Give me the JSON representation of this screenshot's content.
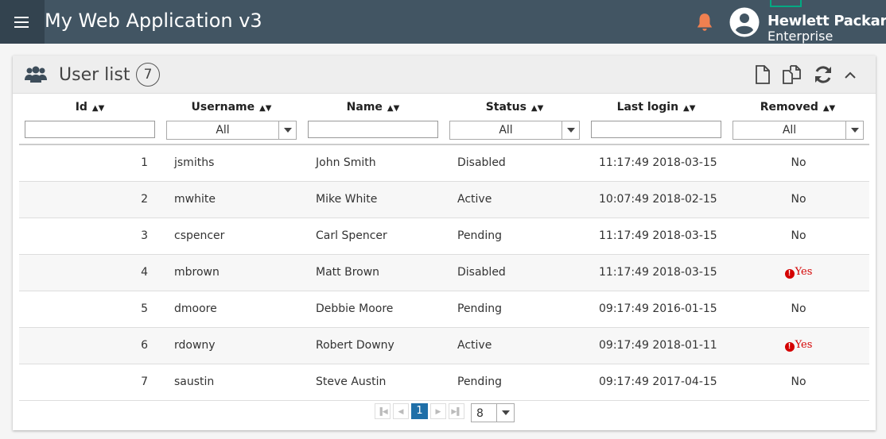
{
  "app": {
    "title": "My Web Application v3"
  },
  "brand": {
    "line1": "Hewlett Packard",
    "line2": "Enterprise"
  },
  "colors": {
    "topbar": "#425563",
    "brand_green": "#01a982",
    "bell": "#f08050",
    "error": "#d40000",
    "page_active": "#1f6fa8"
  },
  "card": {
    "title": "User list",
    "count": "7"
  },
  "columns": [
    {
      "label": "Id"
    },
    {
      "label": "Username"
    },
    {
      "label": "Name"
    },
    {
      "label": "Status"
    },
    {
      "label": "Last login"
    },
    {
      "label": "Removed"
    }
  ],
  "filters": {
    "username": "All",
    "status": "All",
    "removed": "All"
  },
  "rows": [
    {
      "id": "1",
      "username": "jsmiths",
      "name": "John Smith",
      "status": "Disabled",
      "last_login": "11:17:49 2018-03-15",
      "removed": "No"
    },
    {
      "id": "2",
      "username": "mwhite",
      "name": "Mike White",
      "status": "Active",
      "last_login": "10:07:49 2018-02-15",
      "removed": "No"
    },
    {
      "id": "3",
      "username": "cspencer",
      "name": "Carl Spencer",
      "status": "Pending",
      "last_login": "11:17:49 2018-03-15",
      "removed": "No"
    },
    {
      "id": "4",
      "username": "mbrown",
      "name": "Matt Brown",
      "status": "Disabled",
      "last_login": "11:17:49 2018-03-15",
      "removed": "Yes"
    },
    {
      "id": "5",
      "username": "dmoore",
      "name": "Debbie Moore",
      "status": "Pending",
      "last_login": "09:17:49 2016-01-15",
      "removed": "No"
    },
    {
      "id": "6",
      "username": "rdowny",
      "name": "Robert Downy",
      "status": "Active",
      "last_login": "09:17:49 2018-01-11",
      "removed": "Yes"
    },
    {
      "id": "7",
      "username": "saustin",
      "name": "Steve Austin",
      "status": "Pending",
      "last_login": "09:17:49 2017-04-15",
      "removed": "No"
    }
  ],
  "pagination": {
    "current_page": "1",
    "page_size": "8"
  }
}
